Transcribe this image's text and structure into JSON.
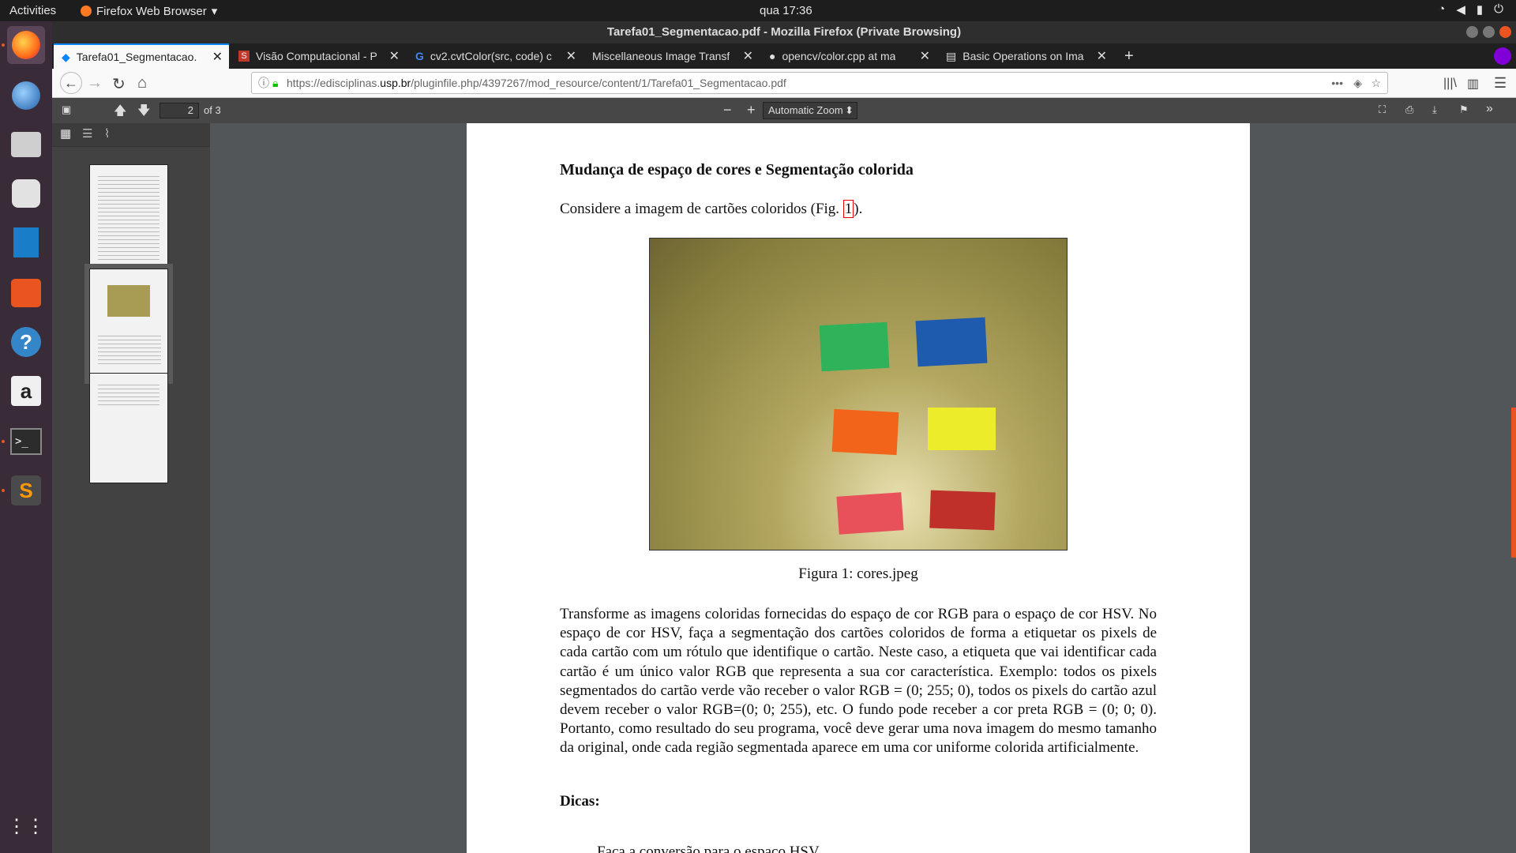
{
  "topbar": {
    "activities": "Activities",
    "app_name": "Firefox Web Browser",
    "clock": "qua 17:36"
  },
  "window": {
    "title": "Tarefa01_Segmentacao.pdf - Mozilla Firefox (Private Browsing)"
  },
  "tabs": [
    {
      "label": "Tarefa01_Segmentacao."
    },
    {
      "label": "Visão Computacional - P"
    },
    {
      "label": "cv2.cvtColor(src, code) c"
    },
    {
      "label": "Miscellaneous Image Transf"
    },
    {
      "label": "opencv/color.cpp at ma"
    },
    {
      "label": "Basic Operations on Ima"
    }
  ],
  "url": {
    "prefix": "https://edisciplinas.",
    "domain": "usp.br",
    "path": "/pluginfile.php/4397267/mod_resource/content/1/Tarefa01_Segmentacao.pdf"
  },
  "pdf_toolbar": {
    "page": "2",
    "of": "of 3",
    "zoom": "Automatic Zoom"
  },
  "document": {
    "heading": "Mudança de espaço de cores e Segmentação colorida",
    "intro_before": "Considere a imagem de cartões coloridos (Fig. ",
    "intro_ref": "1",
    "intro_after": ").",
    "caption": "Figura 1: cores.jpeg",
    "body": "Transforme as imagens coloridas fornecidas do espaço de cor RGB para o espaço de cor HSV. No espaço de cor HSV, faça a segmentação dos cartões coloridos de forma a etiquetar os pixels de cada cartão com um rótulo que identifique o cartão. Neste caso, a etiqueta que vai identificar cada cartão é um único valor RGB que representa a sua cor característica. Exemplo: todos os pixels segmentados do cartão verde vão receber o valor RGB = (0; 255; 0), todos os pixels do cartão azul devem receber o valor RGB=(0; 0; 255), etc. O fundo pode receber a cor preta RGB = (0; 0; 0). Portanto, como resultado do seu programa, você deve gerar uma nova imagem do mesmo tamanho da original, onde cada região segmentada aparece em uma cor uniforme colorida artificialmente.",
    "dicas": "Dicas:",
    "bottom_cut": "Faça a conversão para o espaço HSV"
  },
  "cards": [
    {
      "name": "green",
      "color": "#2fb35a"
    },
    {
      "name": "blue",
      "color": "#1e5aae"
    },
    {
      "name": "orange",
      "color": "#f2641a"
    },
    {
      "name": "yellow",
      "color": "#ecec2a"
    },
    {
      "name": "pink",
      "color": "#e8505a"
    },
    {
      "name": "red",
      "color": "#c0302a"
    }
  ]
}
